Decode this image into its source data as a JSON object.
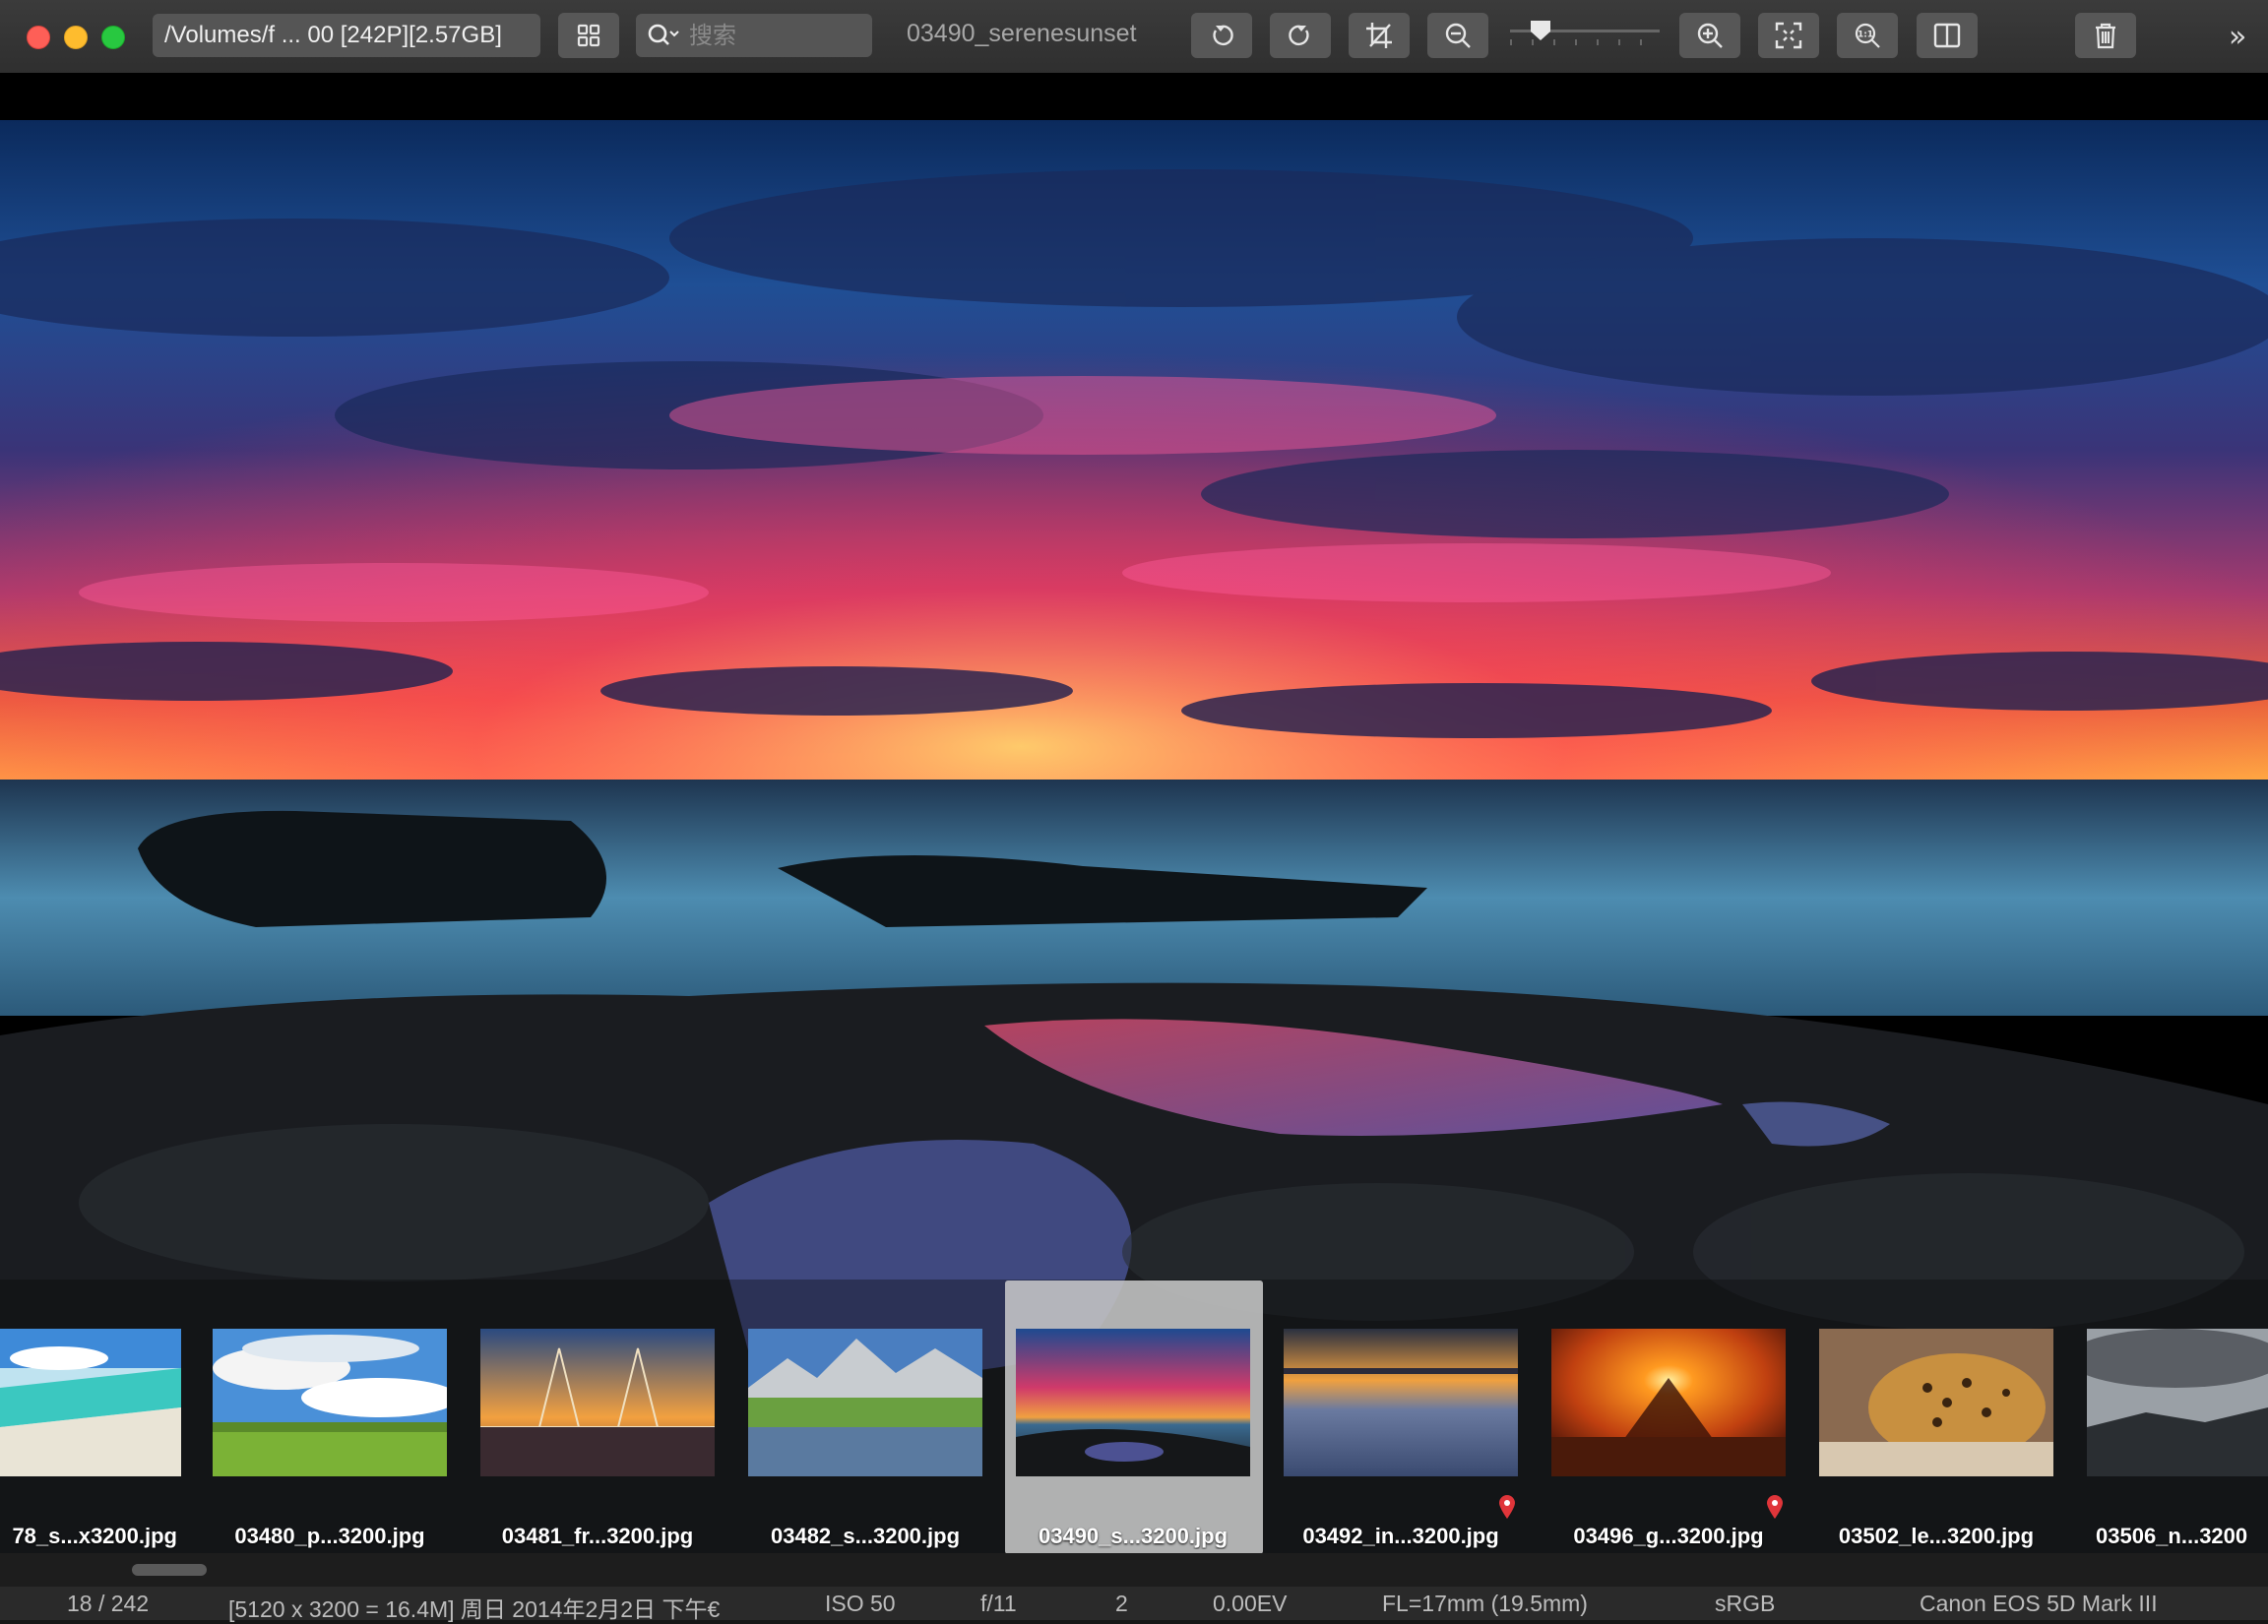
{
  "toolbar": {
    "path": "/Volumes/f ... 00 [242P][2.57GB]",
    "search_placeholder": "搜索",
    "file_title": "03490_serenesunset",
    "zoom_level": 0.15
  },
  "filmstrip": {
    "items": [
      {
        "label": "78_s...x3200.jpg",
        "selected": false,
        "location": false
      },
      {
        "label": "03480_p...3200.jpg",
        "selected": false,
        "location": false
      },
      {
        "label": "03481_fr...3200.jpg",
        "selected": false,
        "location": false
      },
      {
        "label": "03482_s...3200.jpg",
        "selected": false,
        "location": false
      },
      {
        "label": "03490_s...3200.jpg",
        "selected": true,
        "location": false
      },
      {
        "label": "03492_in...3200.jpg",
        "selected": false,
        "location": true
      },
      {
        "label": "03496_g...3200.jpg",
        "selected": false,
        "location": true
      },
      {
        "label": "03502_le...3200.jpg",
        "selected": false,
        "location": false
      },
      {
        "label": "03506_n...3200",
        "selected": false,
        "location": false
      }
    ]
  },
  "status": {
    "position": "18 / 242",
    "info": "[5120 x 3200 = 16.4M] 周日 2014年2月2日  下午€",
    "iso": "ISO 50",
    "aperture": "f/11",
    "shutter": "2",
    "ev": "0.00EV",
    "focal": "FL=17mm (19.5mm)",
    "colorspace": "sRGB",
    "camera": "Canon EOS 5D Mark III"
  },
  "colors": {
    "close": "#fe5f57",
    "minimize": "#febc2e",
    "zoom": "#28c840",
    "pin": "#e0353a"
  },
  "icons": [
    "grid-icon",
    "search-icon",
    "rotate-left-icon",
    "rotate-right-icon",
    "crop-icon",
    "zoom-out-icon",
    "zoom-in-icon",
    "fit-screen-icon",
    "actual-size-icon",
    "split-view-icon",
    "trash-icon",
    "more-chevron-icon",
    "location-pin-icon"
  ]
}
